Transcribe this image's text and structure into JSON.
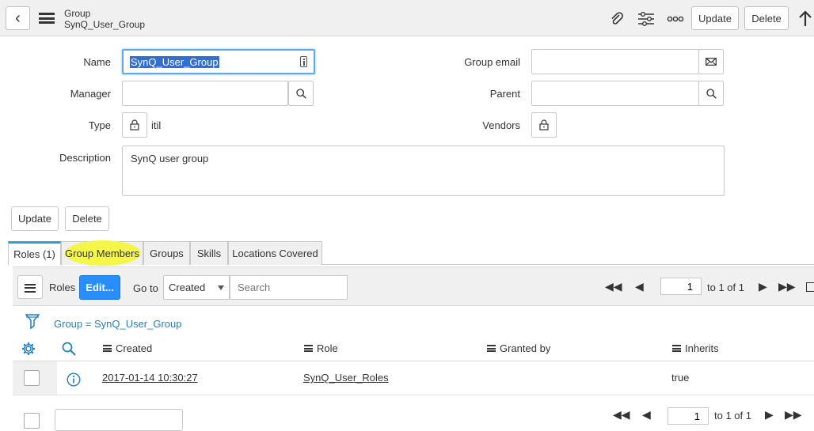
{
  "header": {
    "title": "Group",
    "subtitle": "SynQ_User_Group",
    "update_label": "Update",
    "delete_label": "Delete"
  },
  "form": {
    "name_label": "Name",
    "name_value": "SynQ_User_Group",
    "group_email_label": "Group email",
    "group_email_value": "",
    "manager_label": "Manager",
    "manager_value": "",
    "parent_label": "Parent",
    "parent_value": "",
    "type_label": "Type",
    "type_value": "itil",
    "vendors_label": "Vendors",
    "description_label": "Description",
    "description_value": "SynQ user group",
    "update_label": "Update",
    "delete_label": "Delete"
  },
  "tabs": [
    {
      "label": "Roles (1)"
    },
    {
      "label": "Group Members"
    },
    {
      "label": "Groups"
    },
    {
      "label": "Skills"
    },
    {
      "label": "Locations Covered"
    }
  ],
  "list": {
    "title": "Roles",
    "edit_label": "Edit...",
    "goto_label": "Go to",
    "goto_select": "Created",
    "search_placeholder": "Search",
    "page_value": "1",
    "page_text": "to 1 of 1",
    "filter_text": "Group = SynQ_User_Group",
    "columns": [
      "Created",
      "Role",
      "Granted by",
      "Inherits"
    ],
    "rows": [
      {
        "created": "2017-01-14 10:30:27",
        "role": "SynQ_User_Roles",
        "granted_by": "",
        "inherits": "true"
      }
    ],
    "bottom_page_value": "1",
    "bottom_page_text": "to 1 of 1"
  },
  "colors": {
    "accent": "#2e9cd9",
    "edit_button": "#278efc",
    "highlight": "#f4f73e",
    "link": "#1f7fc6"
  }
}
